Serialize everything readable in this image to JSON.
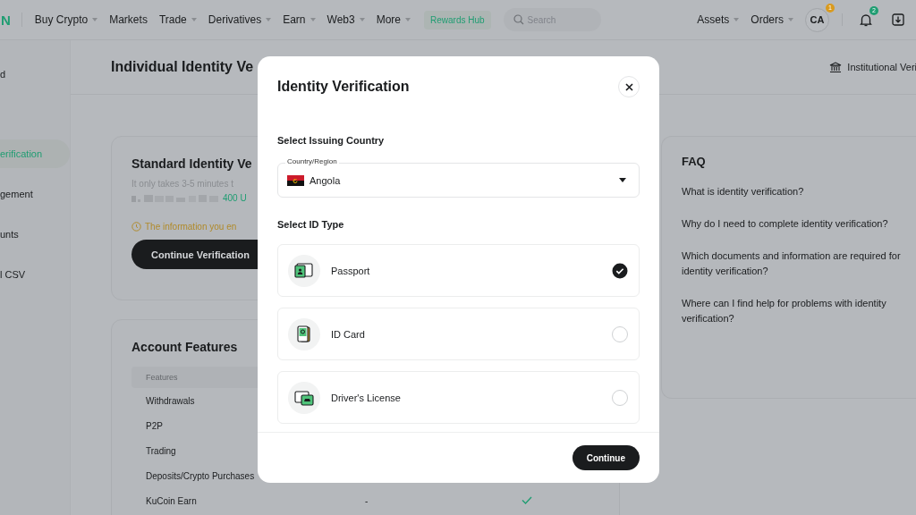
{
  "nav": {
    "logo": "N",
    "items": [
      {
        "label": "Buy Crypto",
        "dropdown": true
      },
      {
        "label": "Markets",
        "dropdown": false
      },
      {
        "label": "Trade",
        "dropdown": true
      },
      {
        "label": "Derivatives",
        "dropdown": true
      },
      {
        "label": "Earn",
        "dropdown": true
      },
      {
        "label": "Web3",
        "dropdown": true
      },
      {
        "label": "More",
        "dropdown": true
      }
    ],
    "rewards": "Rewards Hub",
    "search": {
      "placeholder": "Search"
    },
    "right_items": [
      {
        "label": "Assets"
      },
      {
        "label": "Orders"
      }
    ],
    "avatar": {
      "initials": "CA",
      "badge": "1"
    },
    "notifications": {
      "badge": "2"
    }
  },
  "sidebar": {
    "items": [
      {
        "label": "d",
        "selected": false
      },
      {
        "label": "erification",
        "selected": true
      },
      {
        "label": "gement",
        "selected": false
      },
      {
        "label": "unts",
        "selected": false
      },
      {
        "label": "l CSV",
        "selected": false
      }
    ]
  },
  "header": {
    "title": "Individual Identity Ve",
    "institutional": "Institutional Veri"
  },
  "standard_card": {
    "title": "Standard Identity Ve",
    "subtitle": "It only takes 3-5 minutes t",
    "amount": "400 U",
    "warning": "The information you en",
    "button": "Continue Verification"
  },
  "features_card": {
    "title": "Account Features",
    "column_1": "Features",
    "rows": [
      {
        "feature": "Withdrawals"
      },
      {
        "feature": "P2P"
      },
      {
        "feature": "Trading"
      },
      {
        "feature": "Deposits/Crypto Purchases"
      },
      {
        "feature": "KuCoin Earn",
        "column_2": "-",
        "checked": true
      }
    ]
  },
  "faq": {
    "title": "FAQ",
    "questions": [
      "What is identity verification?",
      "Why do I need to complete identity verification?",
      "Which documents and information are required for identity verification?",
      "Where can I find help for problems with identity verification?"
    ]
  },
  "modal": {
    "title": "Identity Verification",
    "country_heading": "Select Issuing Country",
    "country_field": {
      "label": "Country/Region",
      "value": "Angola"
    },
    "id_heading": "Select ID Type",
    "id_types": [
      {
        "kind": "passport",
        "label": "Passport",
        "selected": true
      },
      {
        "kind": "id_card",
        "label": "ID Card",
        "selected": false
      },
      {
        "kind": "license",
        "label": "Driver's License",
        "selected": false
      }
    ],
    "button": "Continue"
  }
}
